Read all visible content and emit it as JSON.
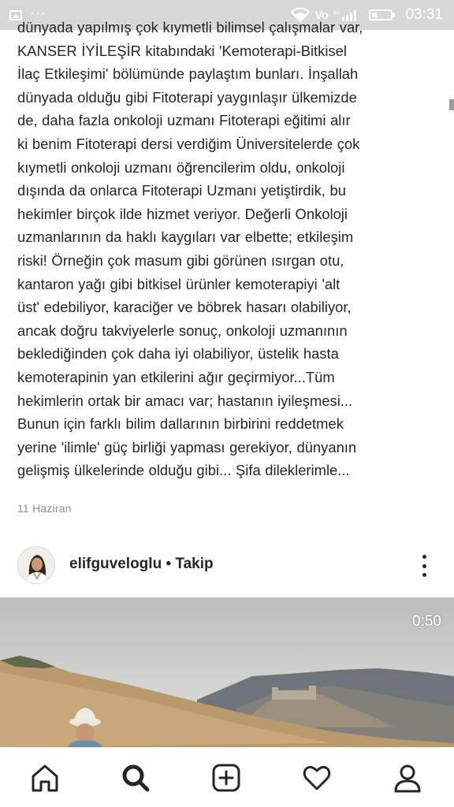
{
  "status_bar": {
    "time": "03:31",
    "network": "Vo",
    "icons": [
      "gallery-icon",
      "more-dots-icon",
      "wifi-icon",
      "volte-icon",
      "signal-icon",
      "battery-icon"
    ]
  },
  "post": {
    "caption_lines": [
      "dünyada yapılmış çok kıymetli bilimsel çalışmalar var,",
      "KANSER İYİLEŞİR kitabındaki 'Kemoterapi-Bitkisel",
      "İlaç Etkileşimi' bölümünde paylaştım bunları.  İnşallah",
      "dünyada olduğu gibi Fitoterapi yaygınlaşır ülkemizde",
      "de, daha fazla onkoloji uzmanı Fitoterapi eğitimi alır",
      "ki benim Fitoterapi dersi verdiğim Üniversitelerde çok",
      "kıymetli onkoloji uzmanı öğrencilerim oldu, onkoloji",
      "dışında da onlarca Fitoterapi Uzmanı yetiştirdik, bu",
      "hekimler birçok ilde hizmet veriyor. Değerli Onkoloji",
      "uzmanlarının da haklı kaygıları var elbette; etkileşim",
      "riski! Örneğin çok masum gibi görünen ısırgan otu,",
      "kantaron yağı gibi bitkisel ürünler kemoterapiyi 'alt",
      "üst' edebiliyor, karaciğer ve böbrek hasarı olabiliyor,",
      "ancak doğru takviyelerle sonuç,  onkoloji uzmanının",
      "beklediğinden çok daha iyi olabiliyor,  üstelik hasta",
      "kemoterapinin yan etkilerini ağır geçirmiyor...Tüm",
      "hekimlerin ortak bir amacı var; hastanın iyileşmesi...",
      "Bunun için farklı bilim dallarının birbirini reddetmek",
      "yerine 'ilimle' güç birliği yapması gerekiyor, dünyanın",
      "gelişmiş ülkelerinde olduğu gibi... Şifa dileklerimle..."
    ],
    "date": "11 Haziran"
  },
  "next_post": {
    "username": "elifguveloglu",
    "separator": " • ",
    "follow_label": "Takip",
    "video_duration": "0:50"
  },
  "bottom_nav": {
    "items": [
      "home-icon",
      "search-icon",
      "add-post-icon",
      "activity-heart-icon",
      "profile-icon"
    ],
    "active": "search-icon"
  },
  "colors": {
    "status_bar_bg": "#d7d7d7",
    "text": "#262626",
    "muted": "#8e8e8e"
  }
}
